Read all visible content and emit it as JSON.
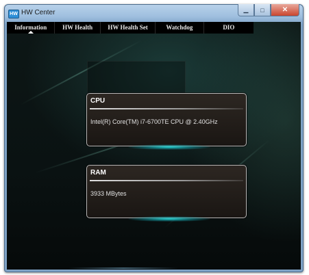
{
  "window": {
    "app_icon_text": "HW",
    "title": "HW Center",
    "minimize_glyph": "▁",
    "maximize_glyph": "□",
    "close_glyph": "✕"
  },
  "tabs": [
    {
      "label": "Information",
      "active": true
    },
    {
      "label": "HW Health",
      "active": false
    },
    {
      "label": "HW Health Set",
      "active": false
    },
    {
      "label": "Watchdog",
      "active": false
    },
    {
      "label": "DIO",
      "active": false
    }
  ],
  "cards": {
    "cpu": {
      "title": "CPU",
      "value": "Intel(R) Core(TM) i7-6700TE CPU @ 2.40GHz"
    },
    "ram": {
      "title": "RAM",
      "value": "3933 MBytes"
    }
  },
  "colors": {
    "glow": "#28e6e6",
    "card_border": "#b9b9b9",
    "tab_bar": "#000000"
  }
}
